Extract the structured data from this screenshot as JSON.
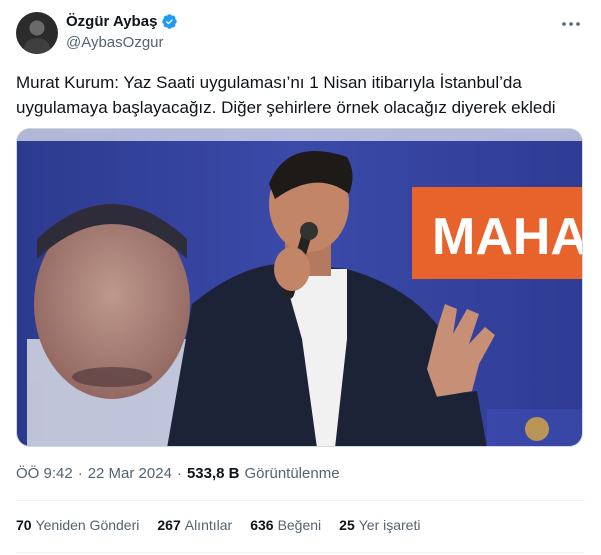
{
  "author": {
    "name": "Özgür Aybaş",
    "handle": "@AybasOzgur",
    "verified": true
  },
  "tweet": {
    "text": "Murat Kurum: Yaz Saati uygulaması’nı 1 Nisan itibarıyla İstanbul’da uygulamaya başlayacağız. Diğer şehirlere örnek olacağız diyerek ekledi",
    "image_banner_text": "MAHA"
  },
  "meta": {
    "time": "ÖÖ 9:42",
    "separator": "·",
    "date": "22 Mar 2024",
    "views_count": "533,8 B",
    "views_label": "Görüntülenme"
  },
  "stats": {
    "retweets_count": "70",
    "retweets_label": "Yeniden Gönderi",
    "quotes_count": "267",
    "quotes_label": "Alıntılar",
    "likes_count": "636",
    "likes_label": "Beğeni",
    "bookmarks_count": "25",
    "bookmarks_label": "Yer işareti"
  },
  "colors": {
    "verified_blue": "#1d9bf0",
    "banner_orange": "#e8622c",
    "backdrop_blue": "#3a47a8"
  },
  "icons": [
    "verified-badge-icon",
    "more-options-icon"
  ]
}
